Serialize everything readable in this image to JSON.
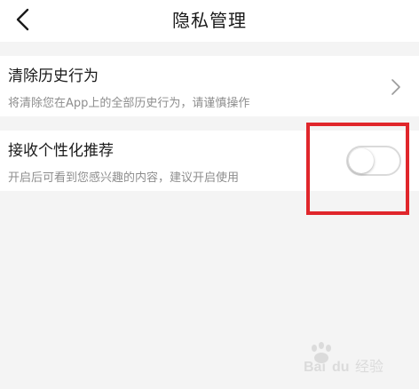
{
  "header": {
    "back_icon": "chevron-left-icon",
    "title": "隐私管理"
  },
  "settings": {
    "clear_history": {
      "title": "清除历史行为",
      "description": "将清除您在App上的全部历史行为，请谨慎操作",
      "icon": "chevron-right-icon"
    },
    "personalized_recommend": {
      "title": "接收个性化推荐",
      "description": "开启后可看到您感兴趣的内容，建议开启使用",
      "enabled": false
    }
  },
  "annotation": {
    "highlight_color": "#e0262b"
  },
  "watermark": {
    "text": "Bai du 经验"
  },
  "colors": {
    "background": "#f4f4f4",
    "card": "#ffffff",
    "primary_text": "#1a1a1a",
    "secondary_text": "#8e8e8e"
  }
}
